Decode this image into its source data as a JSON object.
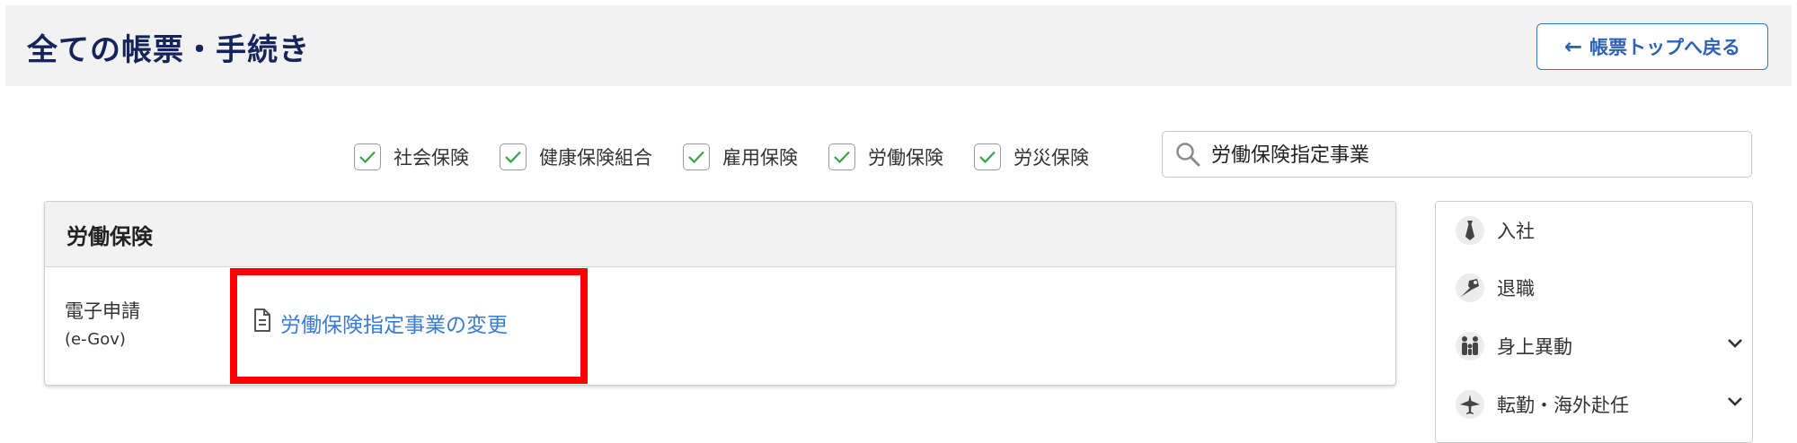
{
  "header": {
    "title": "全ての帳票・手続き",
    "back_button": "帳票トップへ戻る",
    "back_arrow": "←"
  },
  "filters": [
    {
      "label": "社会保険",
      "checked": true
    },
    {
      "label": "健康保険組合",
      "checked": true
    },
    {
      "label": "雇用保険",
      "checked": true
    },
    {
      "label": "労働保険",
      "checked": true
    },
    {
      "label": "労災保険",
      "checked": true
    }
  ],
  "search": {
    "value": "労働保険指定事業"
  },
  "panel": {
    "title": "労働保険",
    "row_label": "電子申請",
    "row_sublabel": "(e-Gov)",
    "link": "労働保険指定事業の変更"
  },
  "side_menu": [
    {
      "label": "入社",
      "icon": "tie-icon",
      "expandable": false
    },
    {
      "label": "退職",
      "icon": "bouquet-icon",
      "expandable": false
    },
    {
      "label": "身上異動",
      "icon": "family-icon",
      "expandable": true
    },
    {
      "label": "転勤・海外赴任",
      "icon": "airplane-icon",
      "expandable": true
    }
  ],
  "colors": {
    "title": "#15245a",
    "link": "#3a7bd5",
    "check": "#3aa04a",
    "highlight": "#ff0000"
  }
}
